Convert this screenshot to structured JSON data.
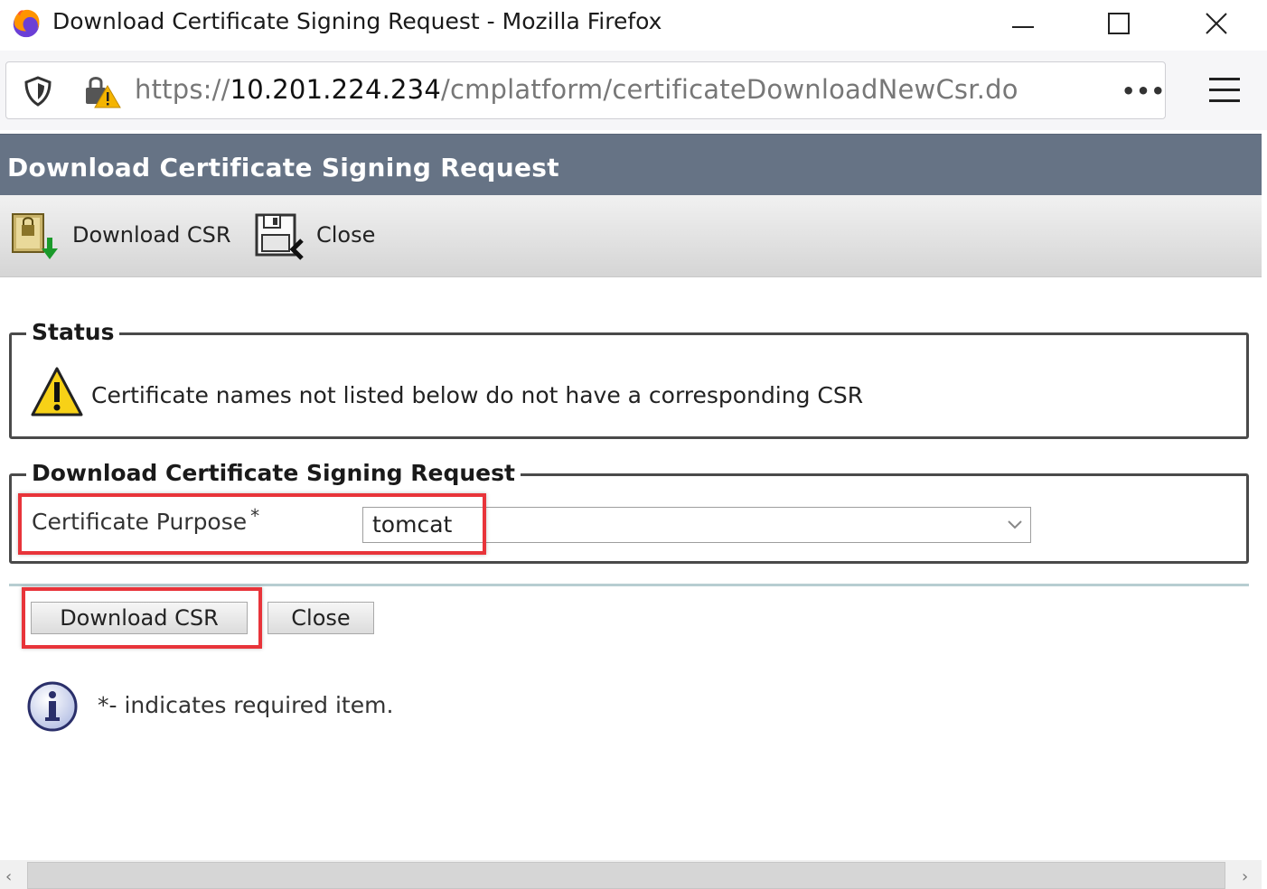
{
  "window": {
    "title": "Download Certificate Signing Request - Mozilla Firefox"
  },
  "urlbar": {
    "scheme": "https://",
    "host": "10.201.224.234",
    "path": "/cmplatform/certificateDownloadNewCsr.do",
    "more_label": "•••"
  },
  "page": {
    "header": "Download Certificate Signing Request"
  },
  "toolbar": {
    "download_label": "Download CSR",
    "close_label": "Close"
  },
  "status": {
    "legend": "Status",
    "message": "Certificate names not listed below do not have a corresponding CSR"
  },
  "form": {
    "legend": "Download Certificate Signing Request",
    "purpose_label": "Certificate Purpose",
    "required_mark": "*",
    "purpose_value": "tomcat"
  },
  "buttons": {
    "download_label": "Download CSR",
    "close_label": "Close"
  },
  "note": {
    "text": "*- indicates required item."
  },
  "colors": {
    "header_bg": "#667385",
    "highlight": "#e8343a"
  }
}
